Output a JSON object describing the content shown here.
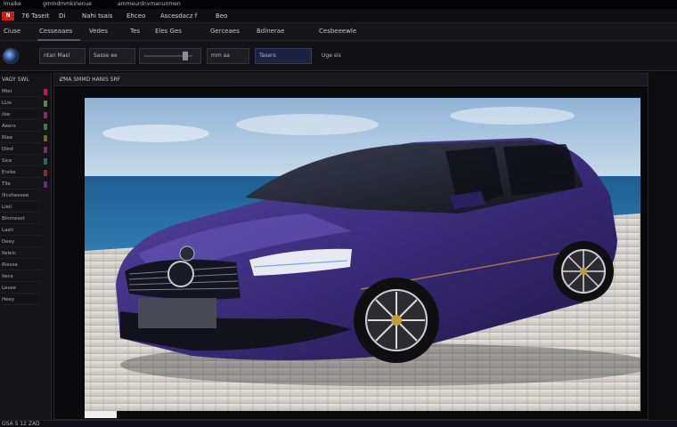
{
  "titlebar": {
    "items": [
      "lmaike",
      "gmmdmmkinenue",
      "ammeurdnvmanunmen"
    ]
  },
  "menubar": {
    "badge": "N",
    "items": [
      "76 Taseit",
      "Di",
      "Nahi tsais",
      "Ehceo",
      "Ascesdacz f",
      "Beo"
    ]
  },
  "tabs": {
    "items": [
      "Ciuse",
      "Cesseaaes",
      "Vedes",
      "Tes",
      "Eles Ges",
      "Gerceaes",
      "Bdinerae",
      "Cesbeeewle"
    ]
  },
  "toolbar": {
    "field_1": "ntan Masl",
    "field_2": "Sasse ee",
    "slider_value": 0.85,
    "field_3": "mm aa",
    "field_4": "Tasers",
    "field_5": "Uge sis"
  },
  "left_panel": {
    "header": "VAGY SWL",
    "rows": [
      "Miei",
      "LLle",
      "llse",
      "Aeers",
      "Rlee",
      "Dlnd",
      "Sice",
      "Enrke",
      "Tlle",
      "lllcsheesee",
      "Lleli",
      "Blnmeset",
      "Lasti",
      "Deey",
      "Ileleic",
      "Rlesse",
      "Ilece",
      "Lesee",
      "Heey"
    ],
    "swatch_colors": [
      "#c2185b",
      "#5d8a3a",
      "#8a2d5c",
      "#3a7d3a",
      "#6a6a2d",
      "#7a2c6a",
      "#2d6a4a",
      "#8d2a3a",
      "#6a2c7d"
    ]
  },
  "canvas": {
    "header_label": "CMA SMMD HANIS SRF",
    "expand_icon": "expand-icon"
  },
  "statusbar": {
    "text": "GSA S 12 ZAD"
  }
}
